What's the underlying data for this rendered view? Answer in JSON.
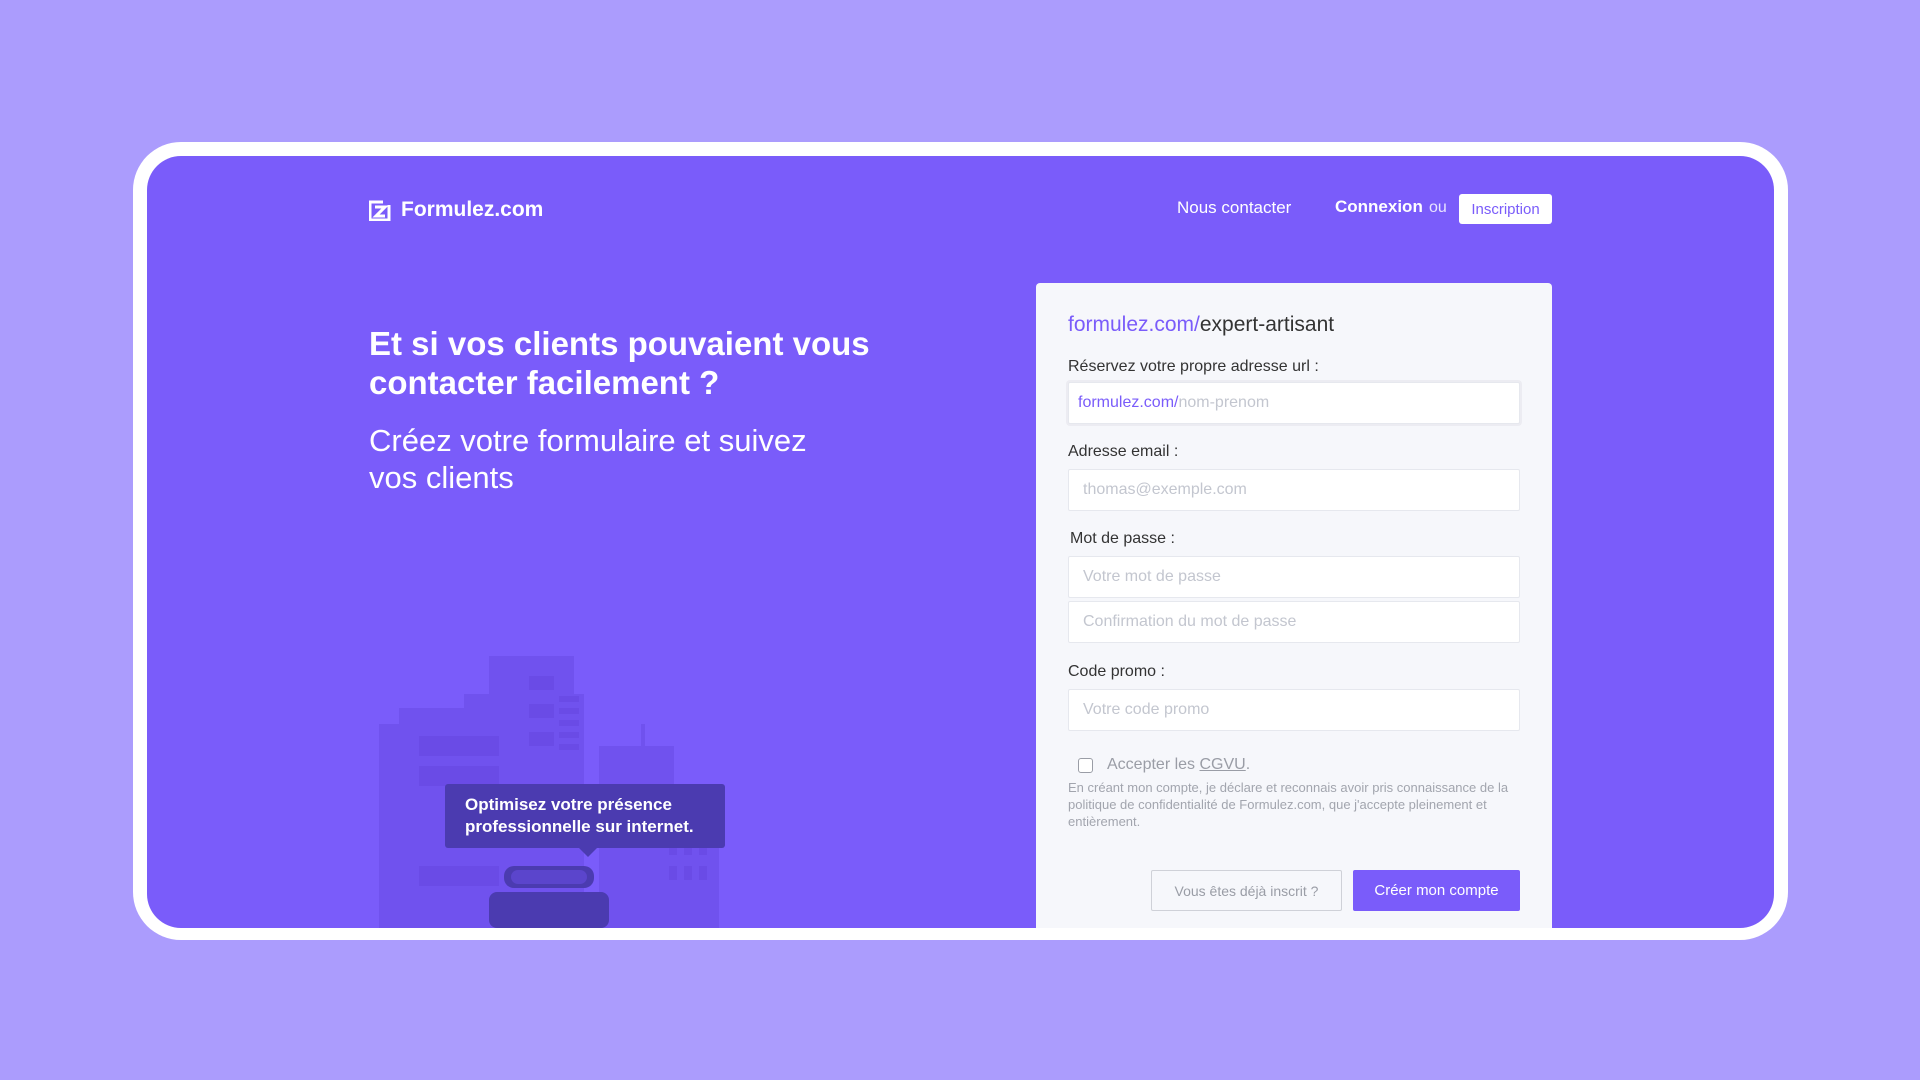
{
  "header": {
    "brand_name": "Formulez.com",
    "nav_contact": "Nous contacter",
    "nav_login": "Connexion",
    "nav_or": "ou",
    "nav_signup": "Inscription"
  },
  "hero": {
    "title": "Et si vos clients pouvaient vous contacter facilement ?",
    "subtitle": "Créez votre formulaire et suivez vos clients",
    "tooltip": "Optimisez votre présence professionnelle sur internet."
  },
  "form": {
    "url_title_prefix": "formulez.com/",
    "url_title_slug": "expert-artisant",
    "url_label": "Réservez votre propre adresse url :",
    "url_prefix": "formulez.com/",
    "url_placeholder": "nom-prenom",
    "email_label": "Adresse email :",
    "email_placeholder": "thomas@exemple.com",
    "password_label": "Mot de passe :",
    "password_placeholder": "Votre mot de passe",
    "password_confirm_placeholder": "Confirmation du mot de passe",
    "promo_label": "Code promo :",
    "promo_placeholder": "Votre code promo",
    "terms_text": "Accepter les",
    "terms_link": "CGVU",
    "terms_end": ".",
    "disclaimer": "En créant mon compte, je déclare et reconnais avoir pris connaissance de la politique de confidentialité de Formulez.com, que j'accepte pleinement et entièrement.",
    "secondary_button": "Vous êtes déjà inscrit ?",
    "primary_button": "Créer mon compte"
  },
  "colors": {
    "page_background": "#ab9cfd",
    "brand_purple": "#7a5cfa",
    "tooltip_dark": "#4b3bb0",
    "card_background": "#f6f7fb"
  },
  "icons": {
    "logo": "formulez-logo-icon",
    "checkbox": "checkbox-unchecked"
  }
}
